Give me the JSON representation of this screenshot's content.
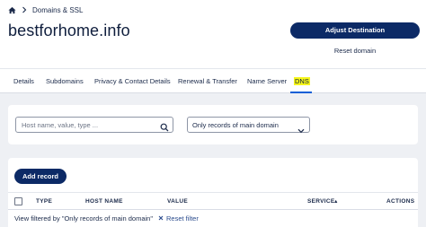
{
  "breadcrumb": {
    "items": [
      "Domains & SSL"
    ]
  },
  "header": {
    "domain": "bestforhome.info",
    "adjust_label": "Adjust Destination",
    "reset_domain_label": "Reset domain"
  },
  "tabs": [
    {
      "label": "Details"
    },
    {
      "label": "Subdomains"
    },
    {
      "label": "Privacy & Contact Details"
    },
    {
      "label": "Renewal & Transfer"
    },
    {
      "label": "Name Server"
    },
    {
      "label": "DNS",
      "active": true
    }
  ],
  "filters": {
    "search_placeholder": "Host name, value, type ...",
    "select_value": "Only records of main domain"
  },
  "table": {
    "add_label": "Add record",
    "headers": {
      "type": "TYPE",
      "host": "HOST NAME",
      "value": "VALUE",
      "service": "SERVICE",
      "actions": "ACTIONS"
    },
    "sort_indicator": "▲",
    "filter_prefix": "View filtered by ",
    "filter_value": "\"Only records of main domain\"",
    "reset_filter_label": "Reset filter"
  },
  "colors": {
    "primary": "#0c2a66",
    "tab_highlight": "#f6f61a",
    "tab_underline": "#0c5fd6"
  },
  "icons": {
    "home": "home-icon",
    "chevron": "chevron-right-icon",
    "search": "search-icon",
    "dropdown": "chevron-down-icon",
    "close": "close-icon"
  }
}
